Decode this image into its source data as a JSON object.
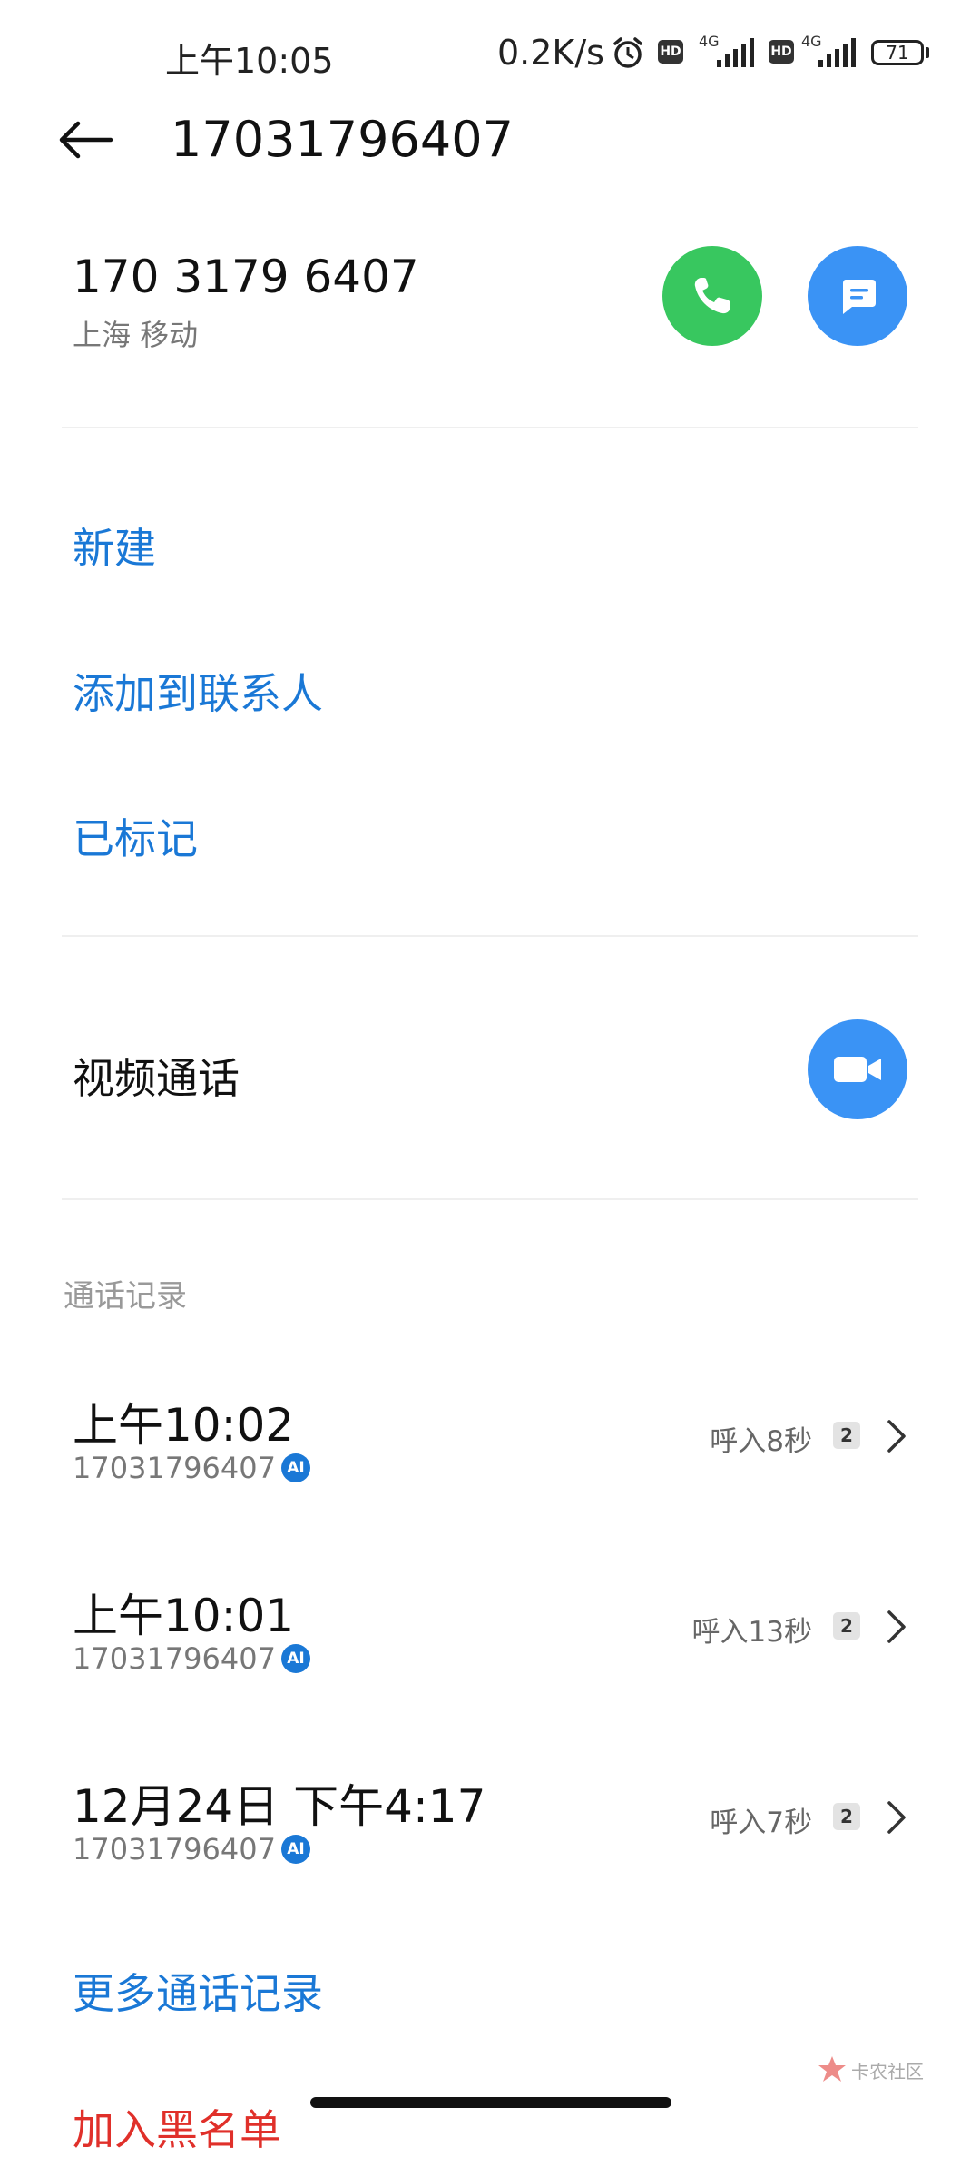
{
  "status_bar": {
    "time": "上午10:05",
    "net_speed": "0.2K/s",
    "hd1": "HD",
    "net1": "4G",
    "hd2": "HD",
    "net2": "4G",
    "battery": "71"
  },
  "header": {
    "title": "17031796407"
  },
  "contact": {
    "number_formatted": "170 3179 6407",
    "carrier": "上海 移动"
  },
  "actions": {
    "new": "新建",
    "add_to_contacts": "添加到联系人",
    "marked": "已标记"
  },
  "video_call": {
    "label": "视频通话"
  },
  "call_log": {
    "header": "通话记录",
    "ai_label": "AI",
    "entries": [
      {
        "time": "上午10:02",
        "number": "17031796407",
        "type": "呼入8秒",
        "sim": "2"
      },
      {
        "time": "上午10:01",
        "number": "17031796407",
        "type": "呼入13秒",
        "sim": "2"
      },
      {
        "time": "12月24日 下午4:17",
        "number": "17031796407",
        "type": "呼入7秒",
        "sim": "2"
      }
    ],
    "more": "更多通话记录"
  },
  "blacklist": {
    "label": "加入黑名单"
  },
  "watermark": {
    "text": "卡农社区"
  },
  "colors": {
    "accent_blue": "#1a78d6",
    "call_green": "#38c75f",
    "button_blue": "#3a93f5",
    "danger_red": "#e0302a"
  },
  "icons": [
    "back-arrow-icon",
    "phone-icon",
    "message-icon",
    "video-camera-icon",
    "chevron-right-icon",
    "alarm-icon",
    "signal-icon",
    "battery-icon"
  ]
}
